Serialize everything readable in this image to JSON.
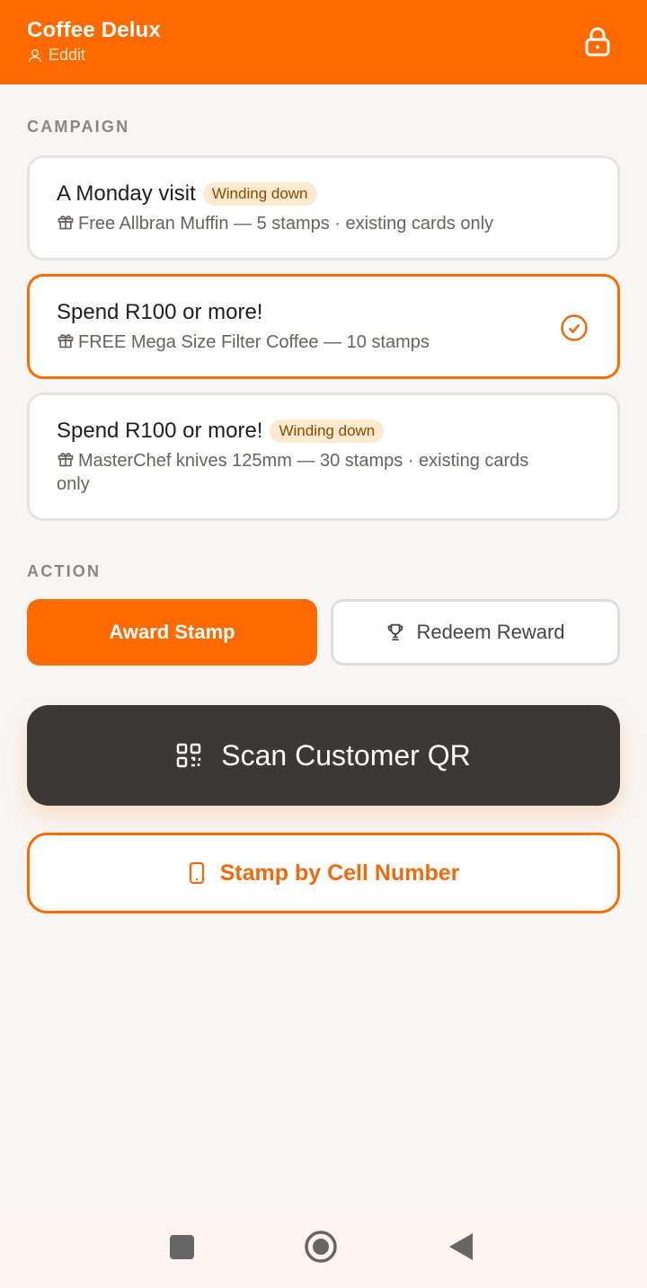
{
  "header": {
    "title": "Coffee Delux",
    "user": "Eddit"
  },
  "campaign_section": {
    "label": "CAMPAIGN",
    "campaigns": [
      {
        "name": "A Monday visit",
        "badge": "Winding down",
        "detail": "Free Allbran Muffin — 5 stamps · existing cards only",
        "selected": false
      },
      {
        "name": "Spend R100 or more!",
        "badge": "",
        "detail": "FREE Mega Size Filter Coffee — 10 stamps",
        "selected": true
      },
      {
        "name": "Spend R100 or more!",
        "badge": "Winding down",
        "detail": "MasterChef knives 125mm — 30 stamps · existing cards only",
        "selected": false
      }
    ]
  },
  "action_section": {
    "label": "ACTION",
    "award_label": "Award Stamp",
    "redeem_label": "Redeem Reward"
  },
  "scan_button": {
    "label": "Scan Customer QR"
  },
  "cell_button": {
    "label": "Stamp by Cell Number"
  },
  "colors": {
    "brand": "#ff6a00",
    "dark": "#3b3836",
    "badge_bg": "#fde9cf"
  },
  "icons": {
    "user": "user-icon",
    "lock": "lock-icon",
    "gift": "gift-icon",
    "check": "check-circle-icon",
    "trophy": "trophy-icon",
    "qr": "qr-code-icon",
    "phone": "phone-icon"
  }
}
